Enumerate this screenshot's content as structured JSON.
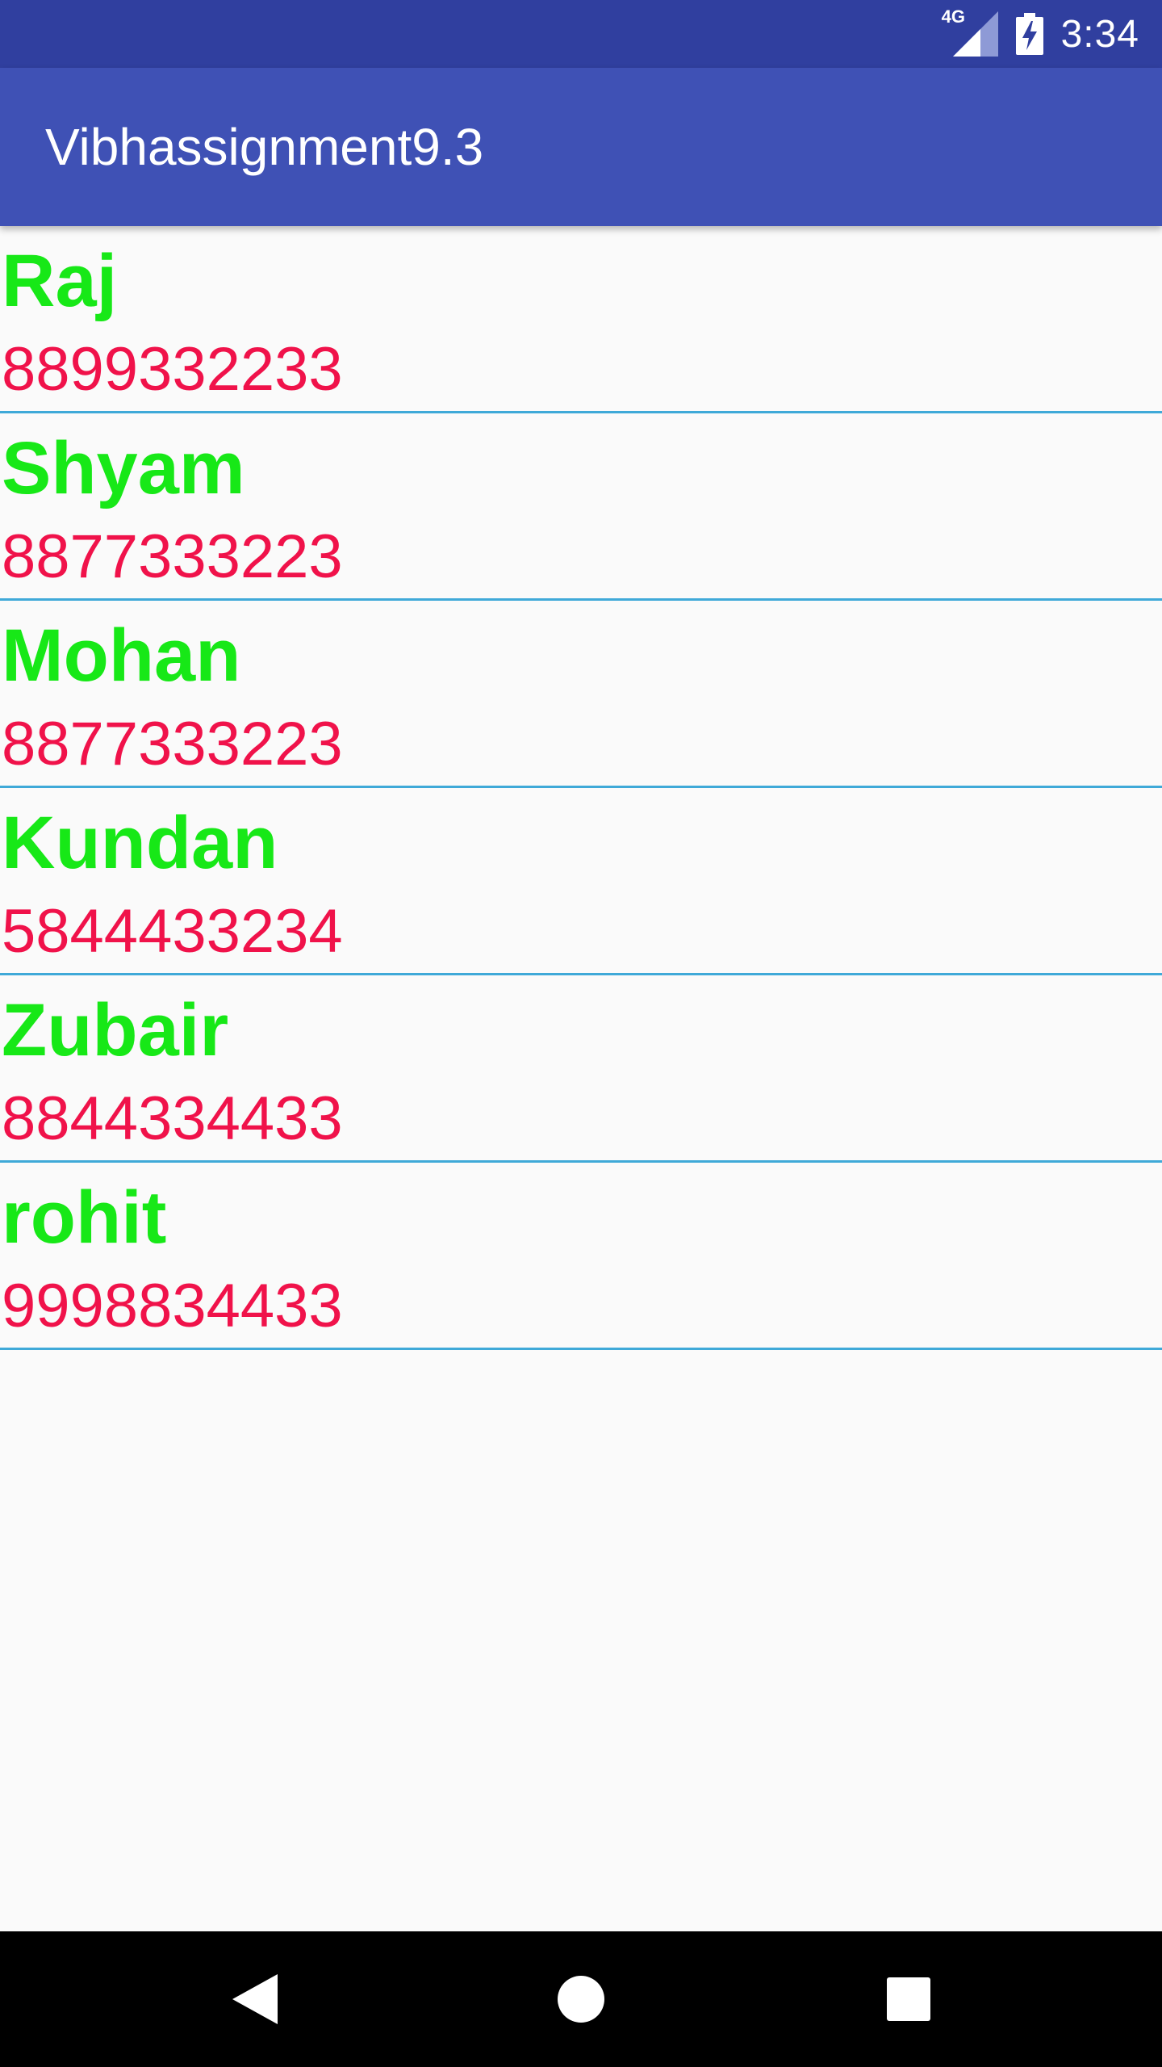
{
  "status_bar": {
    "network": "4G",
    "time": "3:34"
  },
  "app_bar": {
    "title": "Vibhassignment9.3"
  },
  "contacts": [
    {
      "name": "Raj",
      "phone": "8899332233"
    },
    {
      "name": "Shyam",
      "phone": "8877333223"
    },
    {
      "name": "Mohan",
      "phone": "8877333223"
    },
    {
      "name": "Kundan",
      "phone": "5844433234"
    },
    {
      "name": "Zubair",
      "phone": "8844334433"
    },
    {
      "name": "rohit",
      "phone": "9998834433"
    }
  ],
  "nav_bar": {
    "icons": [
      "back-icon",
      "home-icon",
      "recents-icon"
    ]
  },
  "colors": {
    "status_bar": "#303f9f",
    "app_bar": "#3f51b5",
    "name_text": "#17e817",
    "phone_text": "#f0124a",
    "divider": "#3fa9d8",
    "background": "#fafafa",
    "nav_bar": "#000000"
  }
}
